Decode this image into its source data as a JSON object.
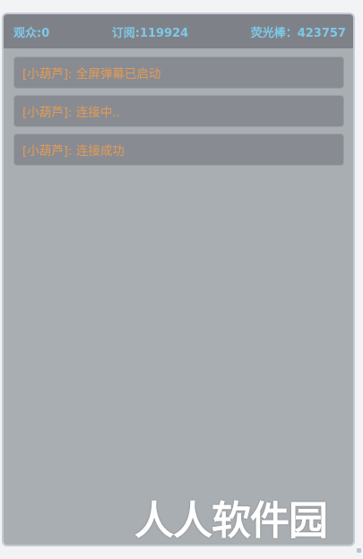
{
  "header": {
    "audience": "观众:0",
    "subscriptions": "订阅:119924",
    "glowsticks": "荧光棒：423757"
  },
  "messages": [
    "[小葫芦]: 全屏弹幕已启动",
    "[小葫芦]: 连接中..",
    "[小葫芦]: 连接成功"
  ],
  "watermark": "人人软件园",
  "colors": {
    "header_text": "#7fc8e8",
    "message_text": "#e69a55",
    "panel_bg": "#a9aeb2",
    "header_bg": "#7e8288"
  }
}
